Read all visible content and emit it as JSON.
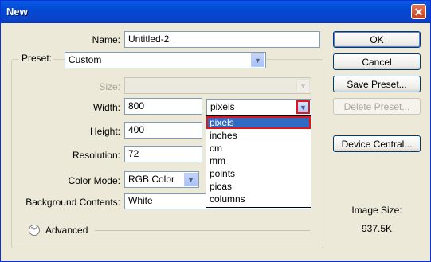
{
  "window": {
    "title": "New"
  },
  "name": {
    "label": "Name:",
    "value": "Untitled-2"
  },
  "preset": {
    "label": "Preset:",
    "value": "Custom"
  },
  "size": {
    "label": "Size:",
    "value": ""
  },
  "width": {
    "label": "Width:",
    "value": "800",
    "unit": "pixels"
  },
  "height": {
    "label": "Height:",
    "value": "400"
  },
  "resolution": {
    "label": "Resolution:",
    "value": "72"
  },
  "color_mode": {
    "label": "Color Mode:",
    "value": "RGB Color"
  },
  "background": {
    "label": "Background Contents:",
    "value": "White"
  },
  "advanced": {
    "label": "Advanced"
  },
  "unit_options": [
    "pixels",
    "inches",
    "cm",
    "mm",
    "points",
    "picas",
    "columns"
  ],
  "selected_unit": "pixels",
  "buttons": {
    "ok": "OK",
    "cancel": "Cancel",
    "save_preset": "Save Preset...",
    "delete_preset": "Delete Preset...",
    "device_central": "Device Central..."
  },
  "image_size": {
    "label": "Image Size:",
    "value": "937.5K"
  },
  "colors": {
    "titlebar": "#0349d2",
    "selection": "#316ac5",
    "highlight_border": "#e0161c",
    "face": "#ece9d8"
  },
  "icons": {
    "close": "close-icon",
    "dropdown": "chevron-down-icon",
    "advanced": "double-chevron-down-icon"
  }
}
